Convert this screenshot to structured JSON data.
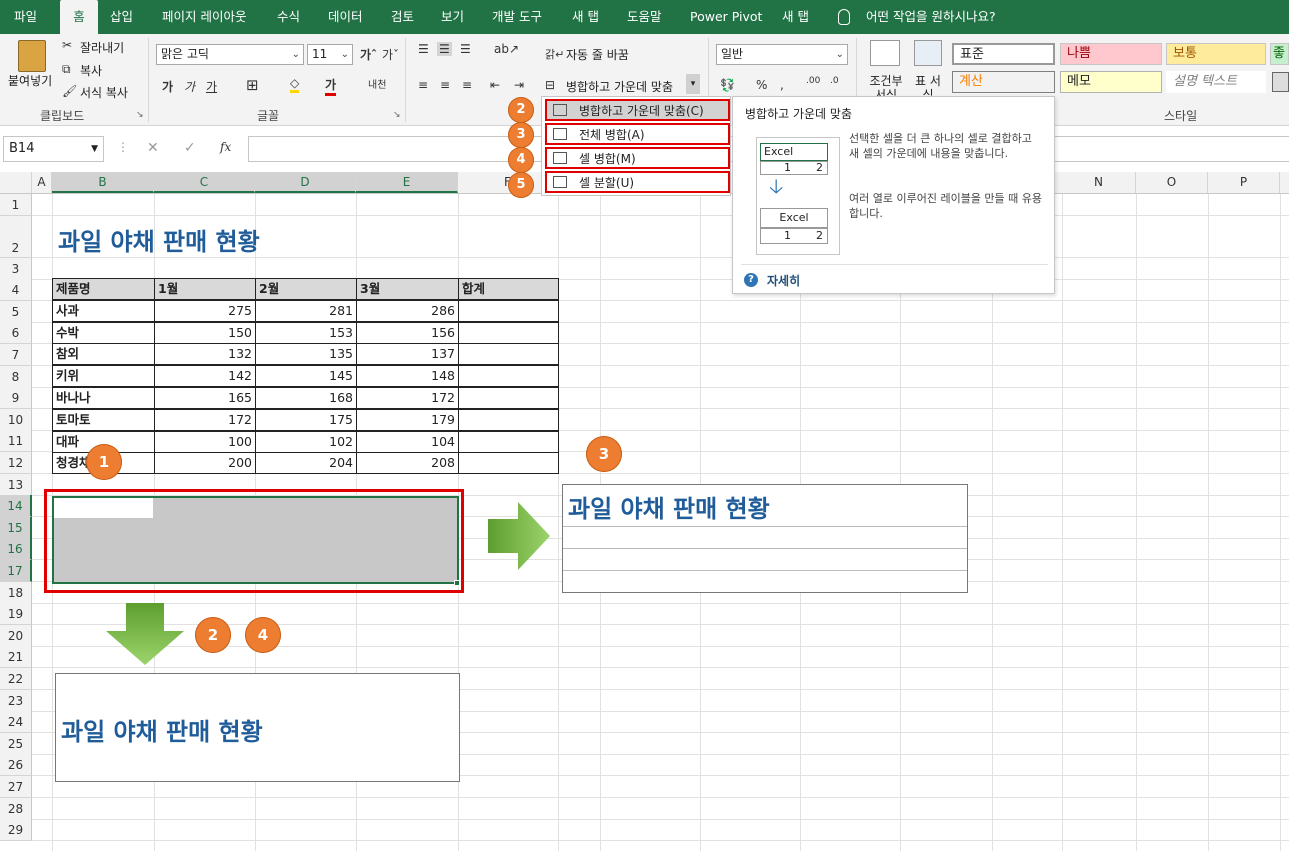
{
  "menu": {
    "tabs": [
      "파일",
      "홈",
      "삽입",
      "페이지 레이아웃",
      "수식",
      "데이터",
      "검토",
      "보기",
      "개발 도구",
      "새 탭",
      "도움말",
      "Power Pivot",
      "새 탭"
    ],
    "active_tab": "홈",
    "tell_me": "어떤 작업을 원하시나요?"
  },
  "ribbon": {
    "clipboard": {
      "paste": "붙여넣기",
      "cut": "잘라내기",
      "copy": "복사",
      "format_painter": "서식 복사",
      "label": "클립보드"
    },
    "font": {
      "name": "맑은 고딕",
      "size": "11",
      "label": "글꼴"
    },
    "alignment": {
      "wrap_text": "자동 줄 바꿈",
      "merge_center": "병합하고 가운데 맞춤"
    },
    "number": {
      "format": "일반"
    },
    "styles": {
      "conditional": "조건부 서식",
      "table": "표 서식",
      "label": "스타일",
      "normal": "표준",
      "bad": "나쁨",
      "neutral": "보통",
      "good": "좋",
      "calc": "계산",
      "memo": "메모",
      "explain": "설명 텍스트"
    }
  },
  "formula_bar": {
    "name_box": "B14",
    "fx": "fx"
  },
  "columns": [
    "A",
    "B",
    "C",
    "D",
    "E",
    "F",
    "N",
    "O",
    "P"
  ],
  "rows": [
    "1",
    "2",
    "3",
    "4",
    "5",
    "6",
    "7",
    "8",
    "9",
    "10",
    "11",
    "12",
    "13",
    "14",
    "15",
    "16",
    "17",
    "18",
    "19",
    "20",
    "21",
    "22",
    "23",
    "24",
    "25",
    "26",
    "27",
    "28",
    "29"
  ],
  "sheet": {
    "title": "과일 야채 판매 현황",
    "headers": [
      "제품명",
      "1월",
      "2월",
      "3월",
      "합계"
    ],
    "data": [
      [
        "사과",
        "275",
        "281",
        "286"
      ],
      [
        "수박",
        "150",
        "153",
        "156"
      ],
      [
        "참외",
        "132",
        "135",
        "137"
      ],
      [
        "키위",
        "142",
        "145",
        "148"
      ],
      [
        "바나나",
        "165",
        "168",
        "172"
      ],
      [
        "토마토",
        "172",
        "175",
        "179"
      ],
      [
        "대파",
        "100",
        "102",
        "104"
      ],
      [
        "청경채",
        "200",
        "204",
        "208"
      ]
    ]
  },
  "dropdown": {
    "items": [
      {
        "badge": "2",
        "label": "병합하고 가운데 맞춤(C)"
      },
      {
        "badge": "3",
        "label": "전체 병합(A)"
      },
      {
        "badge": "4",
        "label": "셀 병합(M)"
      },
      {
        "badge": "5",
        "label": "셀 분할(U)"
      }
    ]
  },
  "tooltip": {
    "title": "병합하고 가운데 맞춤",
    "desc1": "선택한 셀을 더 큰 하나의 셀로 결합하고 새 셀의 가운데에 내용을 맞춥니다.",
    "desc2": "여러 열로 이루어진 레이블을 만들 때 유용합니다.",
    "preview_word": "Excel",
    "preview_1": "1",
    "preview_2": "2",
    "more": "자세히"
  },
  "annotations": {
    "badge1": "1",
    "badge3": "3",
    "badge2": "2",
    "badge4": "4",
    "result_right": "과일 야채 판매 현황",
    "result_bottom": "과일 야채 판매 현황"
  },
  "colors": {
    "excel_green": "#217346",
    "highlight_red": "#e00000",
    "badge_orange": "#ed7d31",
    "title_blue": "#1f5c99"
  }
}
